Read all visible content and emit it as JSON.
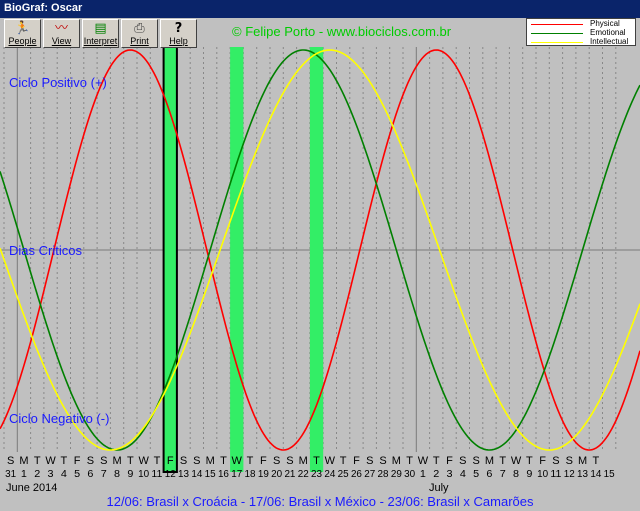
{
  "window": {
    "title": "BioGraf: Oscar"
  },
  "toolbar": {
    "buttons": [
      {
        "label": "People",
        "icon": "people-icon",
        "glyph": "🏃"
      },
      {
        "label": "View",
        "icon": "view-icon",
        "glyph": "〰"
      },
      {
        "label": "Interpret",
        "icon": "interpret-icon",
        "glyph": "▤"
      },
      {
        "label": "Print",
        "icon": "printer-icon",
        "glyph": "⎙"
      },
      {
        "label": "Help",
        "icon": "help-icon",
        "glyph": "?"
      }
    ]
  },
  "copyright": "© Felipe Porto - www.biociclos.com.br",
  "legend": [
    {
      "name": "Physical",
      "color": "#ff0000"
    },
    {
      "name": "Emotional",
      "color": "#008000"
    },
    {
      "name": "Intellectual",
      "color": "#ffff00"
    }
  ],
  "axis_labels": {
    "positive": "Ciclo Positivo (+)",
    "critical": "Dias Criticos",
    "negative": "Ciclo Negativo (-)"
  },
  "months": [
    "June 2014",
    "July"
  ],
  "footer": "12/06: Brasil x Croácia - 17/06: Brasil x México - 23/06: Brasil x Camarões",
  "colors": {
    "background": "#c0c0c0",
    "highlight": "#33ee66",
    "label_blue": "#1a1aff"
  },
  "chart_data": {
    "type": "line",
    "x_dates": [
      "2014-06-01",
      "2014-07-15"
    ],
    "day_letters": [
      "S",
      "M",
      "T",
      "W",
      "T",
      "F",
      "S",
      "S",
      "M",
      "T",
      "W",
      "T",
      "F",
      "S",
      "S",
      "M",
      "T",
      "W",
      "T",
      "F",
      "S",
      "S",
      "M",
      "T",
      "W",
      "T",
      "F",
      "S",
      "S",
      "M",
      "T",
      "W",
      "T",
      "F",
      "S",
      "S",
      "M",
      "T",
      "W",
      "T",
      "F",
      "S",
      "S",
      "M",
      "T"
    ],
    "day_numbers": [
      "31",
      "1",
      "2",
      "3",
      "4",
      "5",
      "6",
      "7",
      "8",
      "9",
      "10",
      "11",
      "12",
      "13",
      "14",
      "15",
      "16",
      "17",
      "18",
      "19",
      "20",
      "21",
      "22",
      "23",
      "24",
      "25",
      "26",
      "27",
      "28",
      "29",
      "30",
      "1",
      "2",
      "3",
      "4",
      "5",
      "6",
      "7",
      "8",
      "9",
      "10",
      "11",
      "12",
      "13",
      "14",
      "15"
    ],
    "ylim": [
      -1,
      1
    ],
    "highlighted_days": [
      "2014-06-12",
      "2014-06-17",
      "2014-06-23"
    ],
    "series": [
      {
        "name": "Physical",
        "period_days": 23,
        "peak_date": "2014-06-09",
        "color": "#ff0000"
      },
      {
        "name": "Emotional",
        "period_days": 28,
        "peak_date": "2014-06-22",
        "color": "#008000"
      },
      {
        "name": "Intellectual",
        "period_days": 33,
        "peak_date": "2014-06-24",
        "color": "#ffff00"
      }
    ]
  }
}
